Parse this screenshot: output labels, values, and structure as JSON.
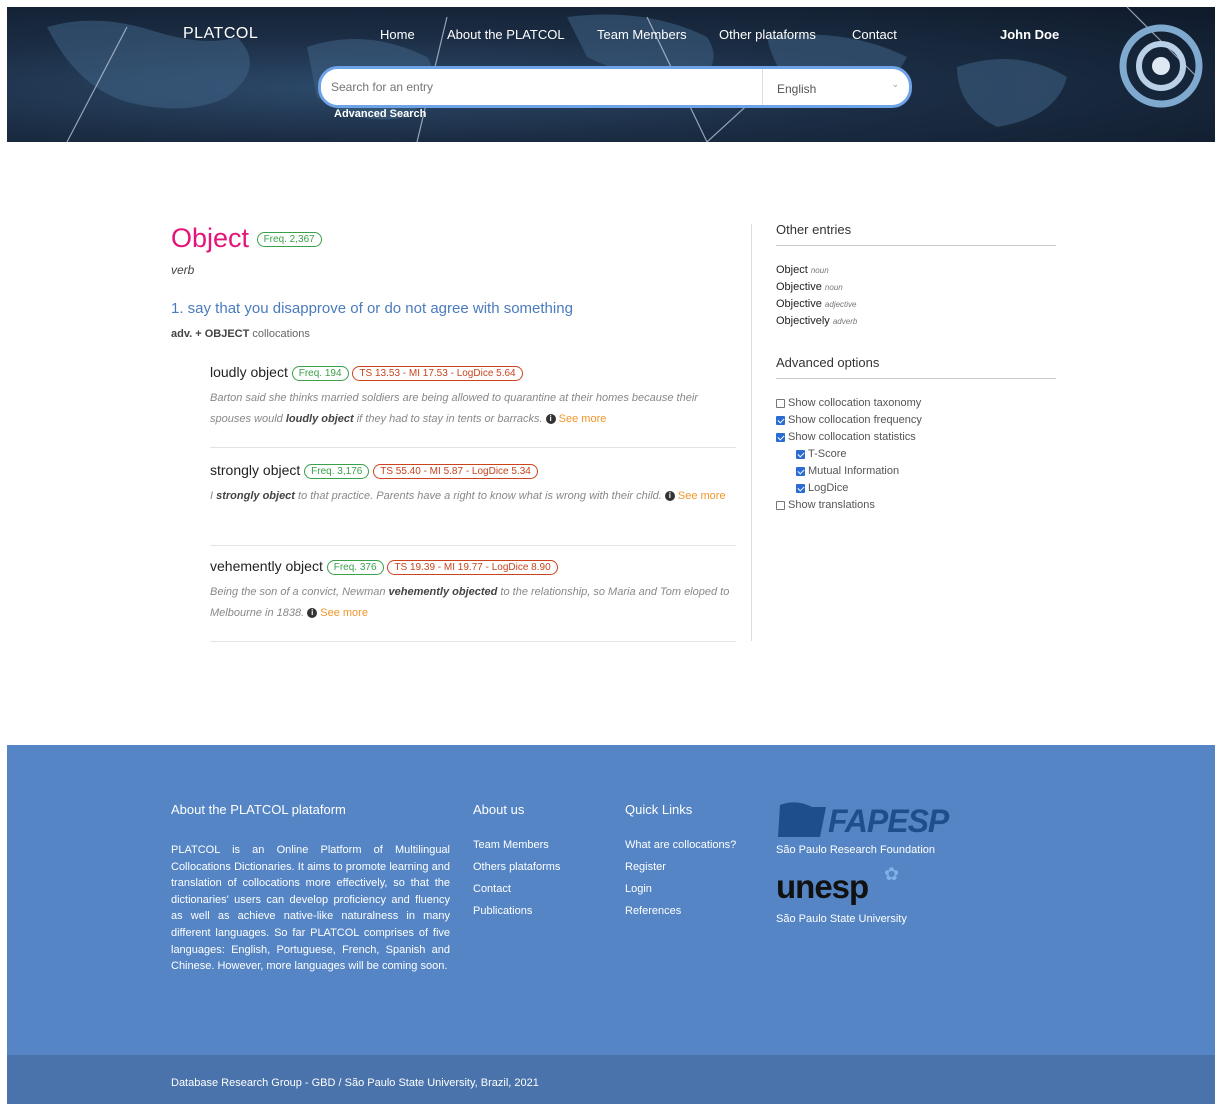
{
  "header": {
    "brand": "PLATCOL",
    "nav": [
      "Home",
      "About the PLATCOL",
      "Team Members",
      "Other plataforms",
      "Contact"
    ],
    "user": "John Doe",
    "search_placeholder": "Search for an entry",
    "language": "English",
    "advanced_search": "Advanced Search"
  },
  "entry": {
    "word": "Object",
    "freq": "Freq. 2,367",
    "pos": "verb",
    "sense": "1. say that you disapprove of or do not agree with something",
    "pattern_prefix": "adv. + OBJECT",
    "pattern_suffix": "collocations",
    "collocations": [
      {
        "phrase": "loudly object",
        "freq": "Freq. 194",
        "stats": "TS 13.53 - MI 17.53 - LogDice 5.64",
        "ex_before": "Barton said she thinks married soldiers are being allowed to quarantine at their homes because their spouses would ",
        "ex_bold": "loudly object",
        "ex_after": " if they had to stay in tents or barracks.",
        "see_more": "See more"
      },
      {
        "phrase": "strongly object",
        "freq": "Freq. 3,176",
        "stats": "TS 55.40 - MI 5.87 - LogDice 5.34",
        "ex_before": "I ",
        "ex_bold": "strongly object",
        "ex_after": " to that practice. Parents have a right to know what is wrong with their child.",
        "see_more": "See more"
      },
      {
        "phrase": "vehemently object",
        "freq": "Freq. 376",
        "stats": "TS 19.39 - MI 19.77 - LogDice 8.90",
        "ex_before": "Being the son of a convict, Newman ",
        "ex_bold": "vehemently objected",
        "ex_after": " to the relationship, so Maria and Tom eloped to Melbourne in 1838.",
        "see_more": "See more"
      }
    ]
  },
  "sidebar": {
    "other_title": "Other entries",
    "others": [
      {
        "word": "Object",
        "pos": "noun"
      },
      {
        "word": "Objective",
        "pos": "noun"
      },
      {
        "word": "Objective",
        "pos": "adjective"
      },
      {
        "word": "Objectively",
        "pos": "adverb"
      }
    ],
    "adv_title": "Advanced options",
    "options": [
      {
        "label": "Show collocation taxonomy",
        "checked": false,
        "indent": false
      },
      {
        "label": "Show collocation frequency",
        "checked": true,
        "indent": false
      },
      {
        "label": "Show collocation statistics",
        "checked": true,
        "indent": false
      },
      {
        "label": "T-Score",
        "checked": true,
        "indent": true
      },
      {
        "label": "Mutual Information",
        "checked": true,
        "indent": true
      },
      {
        "label": "LogDice",
        "checked": true,
        "indent": true
      },
      {
        "label": "Show translations",
        "checked": false,
        "indent": false
      }
    ]
  },
  "footer": {
    "about_title": "About the PLATCOL plataform",
    "about_text": "PLATCOL is an Online Platform of Multilingual Collocations Dictionaries. It aims to promote learning and translation of collocations more effectively, so that the dictionaries' users can develop proficiency and fluency as well as achieve native-like naturalness in many different languages. So far PLATCOL comprises of five languages: English, Portuguese, French, Spanish and Chinese. However, more languages will be coming soon.",
    "aboutus_title": "About us",
    "aboutus_links": [
      "Team Members",
      "Others plataforms",
      "Contact",
      "Publications"
    ],
    "quick_title": "Quick Links",
    "quick_links": [
      "What are collocations?",
      "Register",
      "Login",
      "References"
    ],
    "fapesp_logo": "FAPESP",
    "fapesp_caption": "São Paulo Research Foundation",
    "unesp_logo": "unesp",
    "unesp_caption": "São Paulo State University",
    "copyright": "Database Research Group - GBD / São Paulo State University, Brazil, 2021"
  }
}
